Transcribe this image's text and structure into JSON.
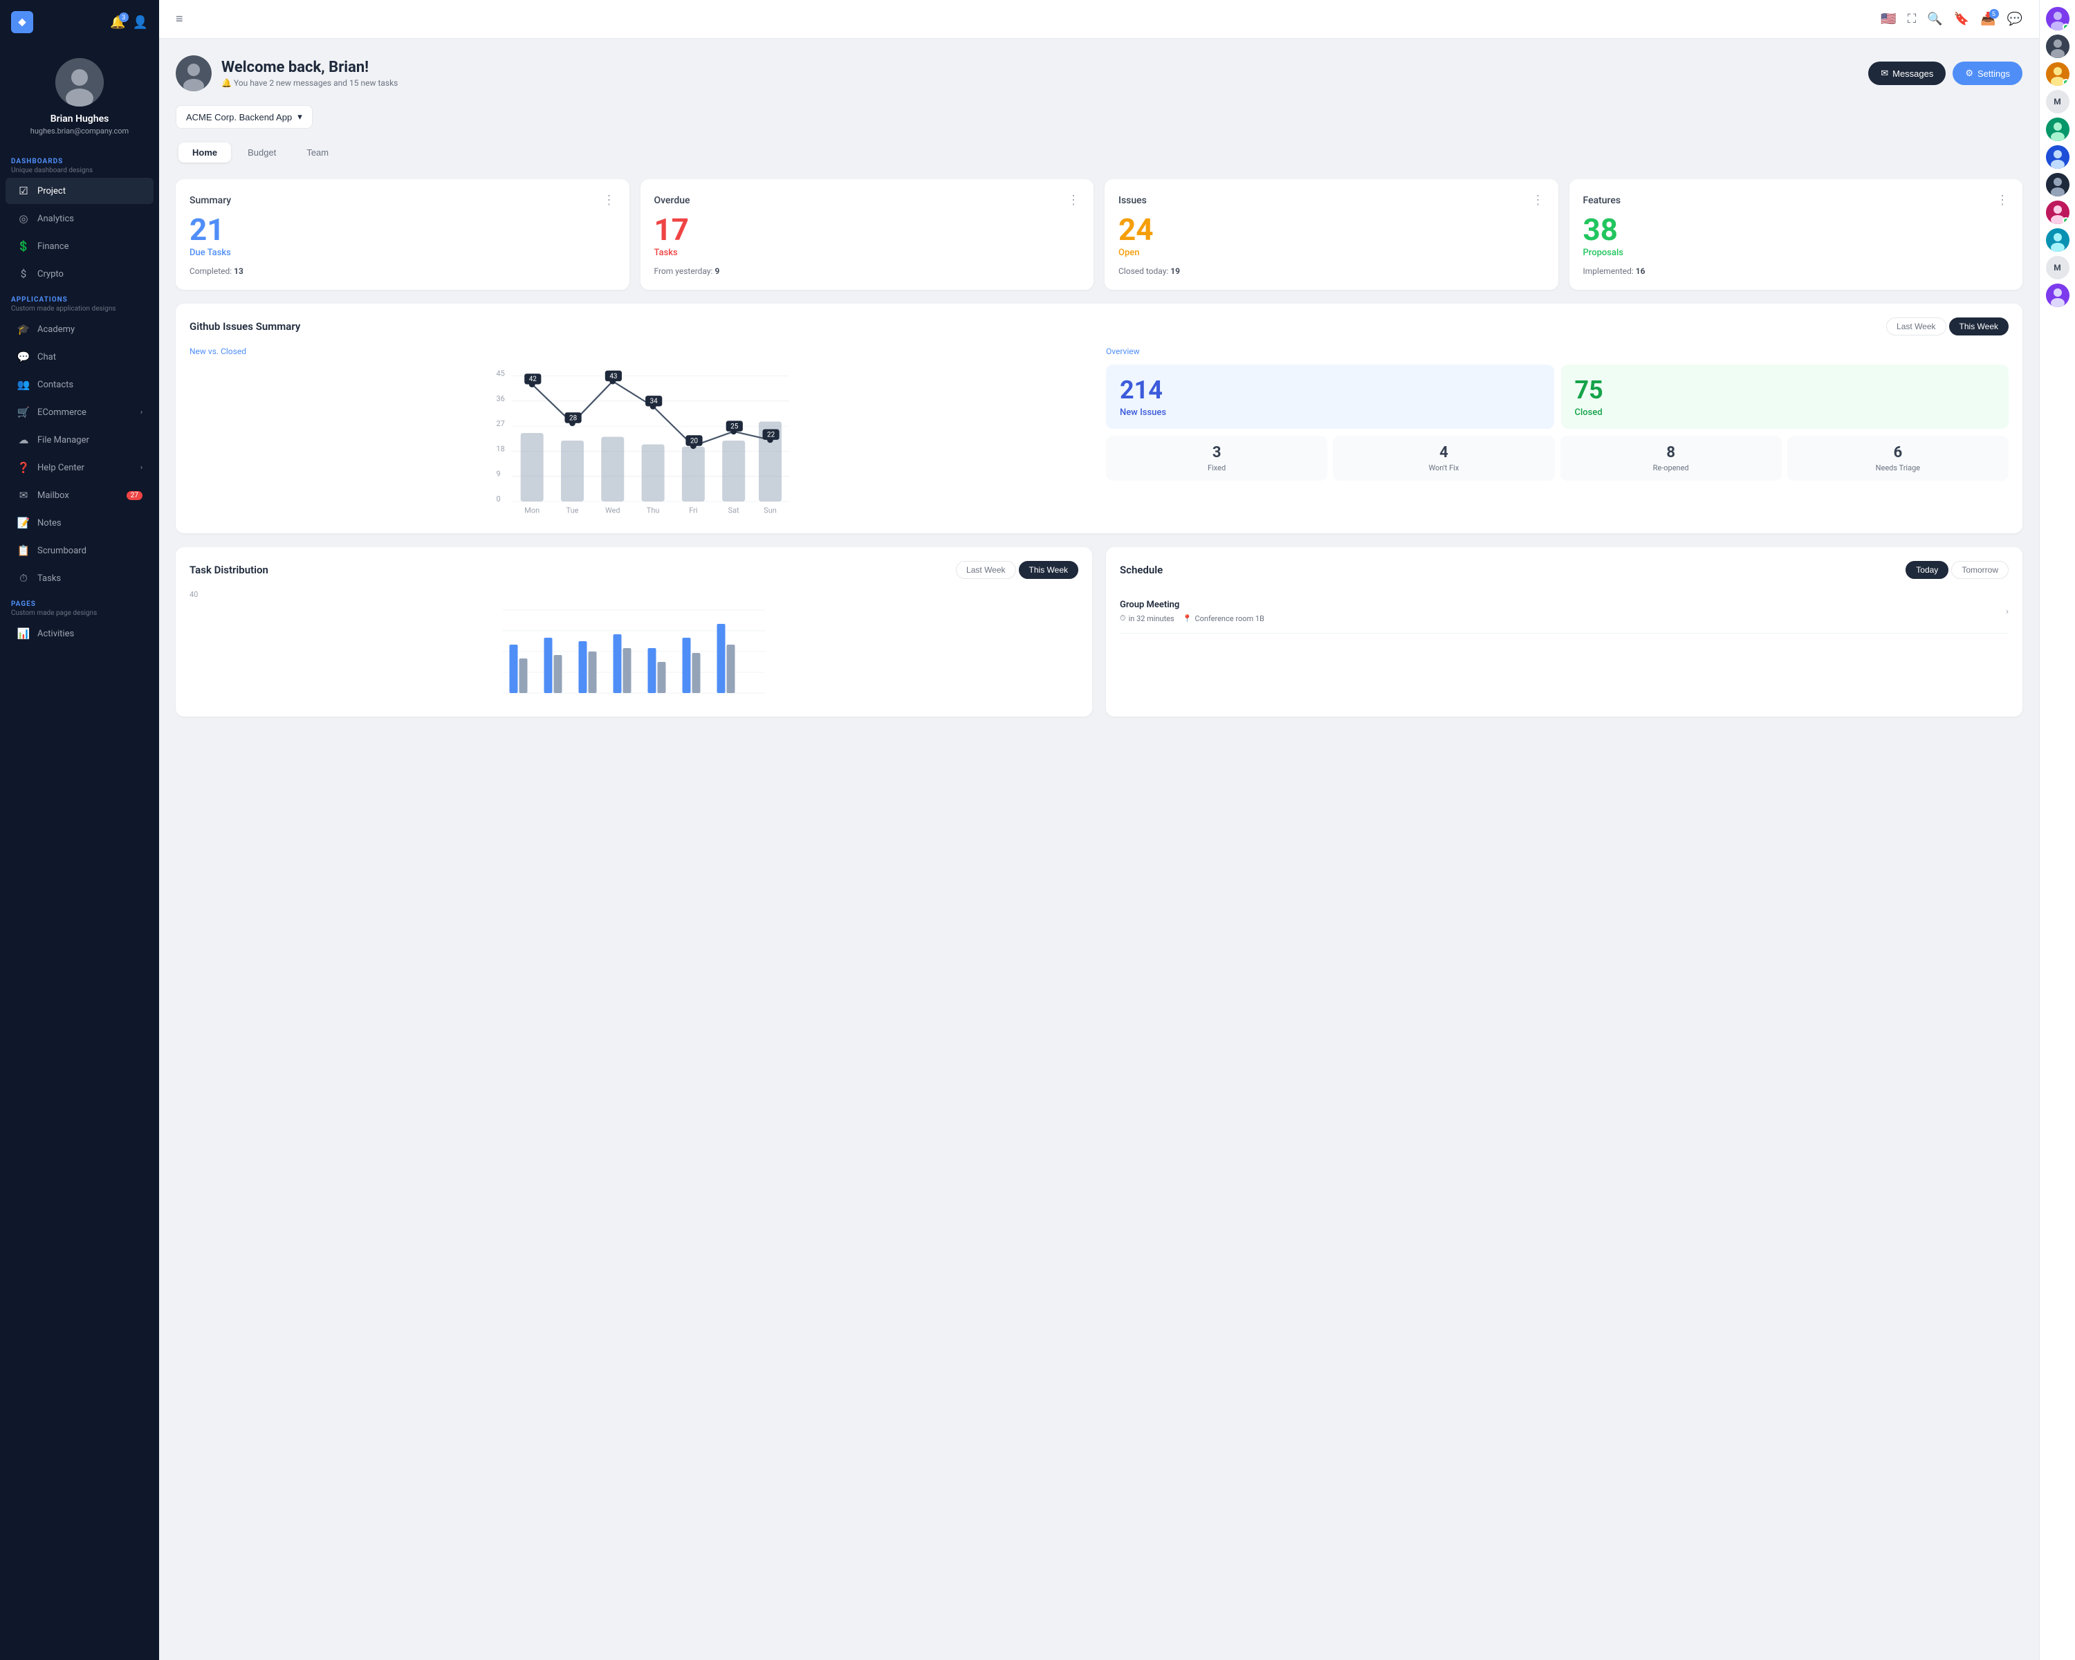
{
  "sidebar": {
    "logo": "◆",
    "user": {
      "name": "Brian Hughes",
      "email": "hughes.brian@company.com"
    },
    "notif_count": "3",
    "sections": [
      {
        "label": "DASHBOARDS",
        "sub": "Unique dashboard designs",
        "items": [
          {
            "id": "project",
            "icon": "☑",
            "label": "Project",
            "active": true
          },
          {
            "id": "analytics",
            "icon": "◎",
            "label": "Analytics"
          },
          {
            "id": "finance",
            "icon": "💲",
            "label": "Finance"
          },
          {
            "id": "crypto",
            "icon": "$",
            "label": "Crypto"
          }
        ]
      },
      {
        "label": "APPLICATIONS",
        "sub": "Custom made application designs",
        "items": [
          {
            "id": "academy",
            "icon": "🎓",
            "label": "Academy"
          },
          {
            "id": "chat",
            "icon": "💬",
            "label": "Chat"
          },
          {
            "id": "contacts",
            "icon": "👥",
            "label": "Contacts"
          },
          {
            "id": "ecommerce",
            "icon": "🛒",
            "label": "ECommerce",
            "arrow": "›"
          },
          {
            "id": "filemanager",
            "icon": "☁",
            "label": "File Manager"
          },
          {
            "id": "helpcenter",
            "icon": "❓",
            "label": "Help Center",
            "arrow": "›"
          },
          {
            "id": "mailbox",
            "icon": "✉",
            "label": "Mailbox",
            "badge": "27"
          },
          {
            "id": "notes",
            "icon": "📝",
            "label": "Notes"
          },
          {
            "id": "scrumboard",
            "icon": "📋",
            "label": "Scrumboard"
          },
          {
            "id": "tasks",
            "icon": "⏱",
            "label": "Tasks"
          }
        ]
      },
      {
        "label": "PAGES",
        "sub": "Custom made page designs",
        "items": [
          {
            "id": "activities",
            "icon": "📊",
            "label": "Activities"
          }
        ]
      }
    ]
  },
  "topnav": {
    "hamburger": "≡",
    "flag": "🇺🇸",
    "notifications_badge": "5"
  },
  "welcome": {
    "greeting": "Welcome back, Brian!",
    "subtext": "You have 2 new messages and 15 new tasks",
    "messages_btn": "Messages",
    "settings_btn": "Settings"
  },
  "project_selector": {
    "label": "ACME Corp. Backend App",
    "arrow": "▾"
  },
  "tabs": [
    {
      "id": "home",
      "label": "Home",
      "active": true
    },
    {
      "id": "budget",
      "label": "Budget"
    },
    {
      "id": "team",
      "label": "Team"
    }
  ],
  "summary_cards": [
    {
      "title": "Summary",
      "number": "21",
      "number_color": "blue",
      "label": "Due Tasks",
      "label_color": "blue",
      "sub_key": "Completed:",
      "sub_val": "13"
    },
    {
      "title": "Overdue",
      "number": "17",
      "number_color": "red",
      "label": "Tasks",
      "label_color": "red",
      "sub_key": "From yesterday:",
      "sub_val": "9"
    },
    {
      "title": "Issues",
      "number": "24",
      "number_color": "orange",
      "label": "Open",
      "label_color": "orange",
      "sub_key": "Closed today:",
      "sub_val": "19"
    },
    {
      "title": "Features",
      "number": "38",
      "number_color": "green",
      "label": "Proposals",
      "label_color": "green",
      "sub_key": "Implemented:",
      "sub_val": "16"
    }
  ],
  "github": {
    "title": "Github Issues Summary",
    "week_tabs": [
      "Last Week",
      "This Week"
    ],
    "active_week": "This Week",
    "chart_subtitle": "New vs. Closed",
    "days": [
      "Mon",
      "Tue",
      "Wed",
      "Thu",
      "Fri",
      "Sat",
      "Sun"
    ],
    "line_values": [
      42,
      28,
      43,
      34,
      20,
      25,
      22
    ],
    "bar_values": [
      30,
      25,
      28,
      22,
      20,
      25,
      35
    ],
    "y_labels": [
      "45",
      "36",
      "27",
      "18",
      "9",
      "0"
    ],
    "overview_title": "Overview",
    "new_issues": "214",
    "new_issues_label": "New Issues",
    "closed": "75",
    "closed_label": "Closed",
    "mini_stats": [
      {
        "num": "3",
        "label": "Fixed"
      },
      {
        "num": "4",
        "label": "Won't Fix"
      },
      {
        "num": "8",
        "label": "Re-opened"
      },
      {
        "num": "6",
        "label": "Needs Triage"
      }
    ]
  },
  "task_dist": {
    "title": "Task Distribution",
    "week_tabs": [
      "Last Week",
      "This Week"
    ],
    "active_week": "This Week",
    "chart_label": "40"
  },
  "schedule": {
    "title": "Schedule",
    "day_tabs": [
      "Today",
      "Tomorrow"
    ],
    "active_day": "Today",
    "items": [
      {
        "title": "Group Meeting",
        "time": "in 32 minutes",
        "location": "Conference room 1B"
      }
    ]
  },
  "right_panel": {
    "avatars": [
      {
        "id": "a1",
        "initials": "",
        "online": true
      },
      {
        "id": "a2",
        "initials": "",
        "online": false
      },
      {
        "id": "a3",
        "initials": "",
        "online": true
      },
      {
        "id": "a4",
        "initials": "M",
        "online": false
      },
      {
        "id": "a5",
        "initials": "",
        "online": false
      },
      {
        "id": "a6",
        "initials": "",
        "online": false
      },
      {
        "id": "a7",
        "initials": "",
        "online": false
      },
      {
        "id": "a8",
        "initials": "",
        "online": true
      },
      {
        "id": "a9",
        "initials": "",
        "online": false
      },
      {
        "id": "a10",
        "initials": "M",
        "online": false
      },
      {
        "id": "a11",
        "initials": "",
        "online": false
      }
    ]
  }
}
